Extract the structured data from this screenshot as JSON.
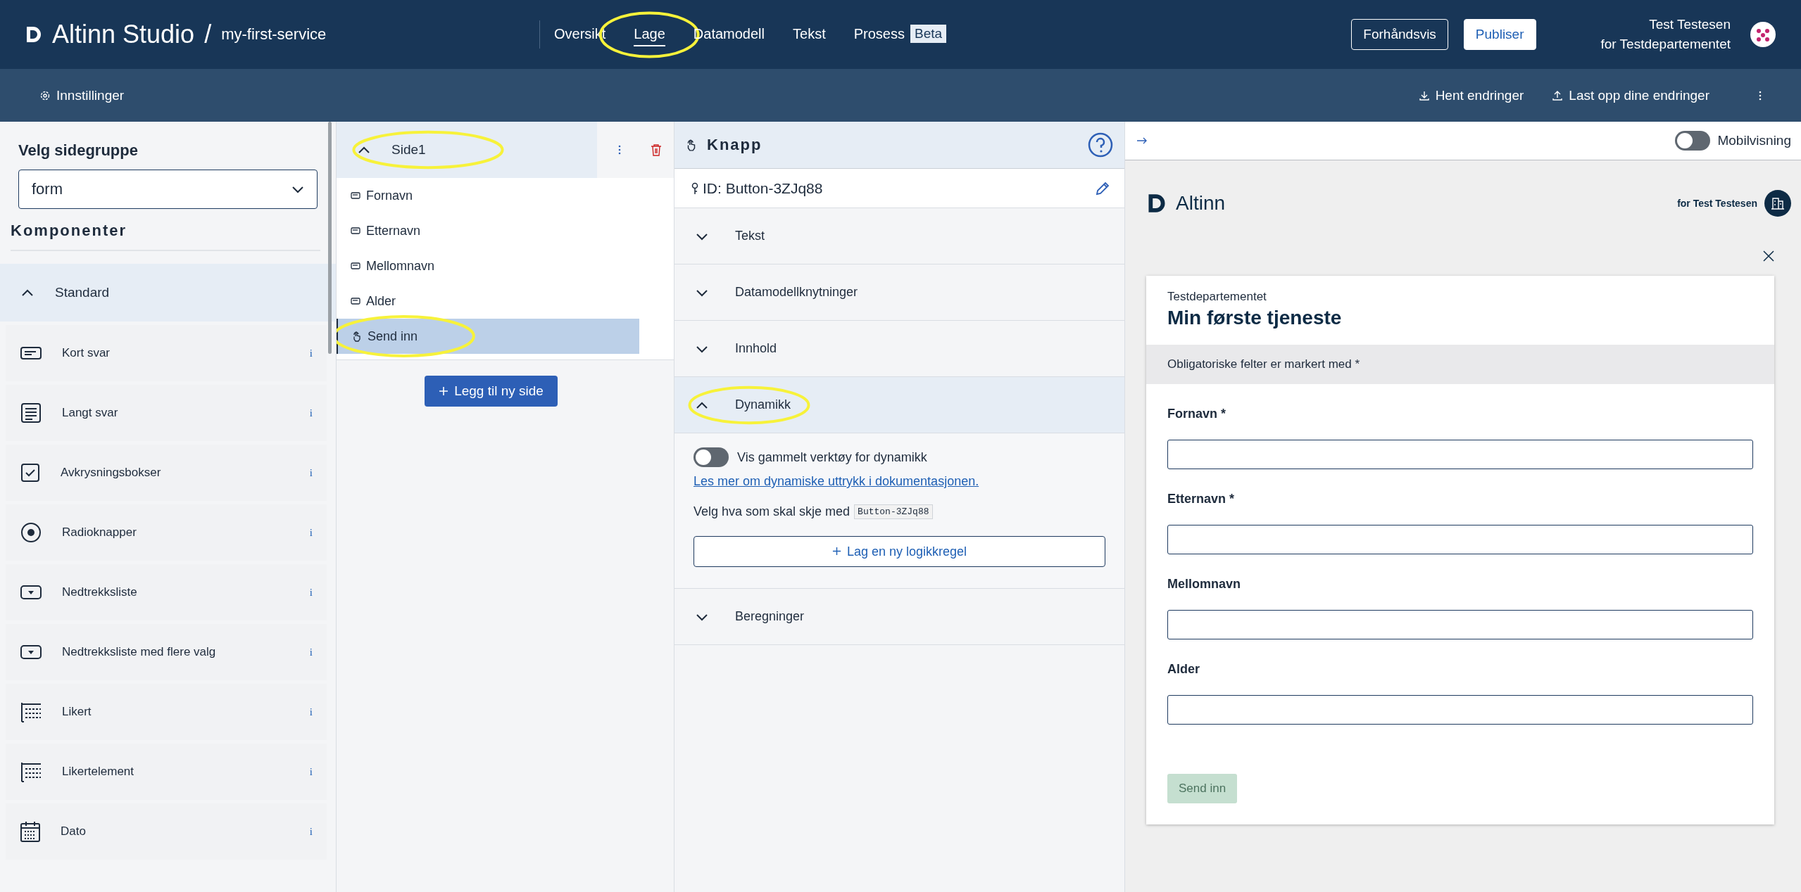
{
  "header": {
    "logo": "Altinn Studio",
    "separator": "/",
    "app_name": "my-first-service",
    "nav": [
      {
        "label": "Oversikt",
        "selected": false,
        "annotated": false
      },
      {
        "label": "Lage",
        "selected": true,
        "annotated": true
      },
      {
        "label": "Datamodell",
        "selected": false,
        "annotated": false
      },
      {
        "label": "Tekst",
        "selected": false,
        "annotated": false
      },
      {
        "label": "Prosess",
        "badge": "Beta",
        "selected": false,
        "annotated": false
      }
    ],
    "preview_button": "Forhåndsvis",
    "publish_button": "Publiser",
    "user": {
      "name": "Test Testesen",
      "org": "for Testdepartementet"
    }
  },
  "subbar": {
    "settings": "Innstillinger",
    "fetch": "Hent endringer",
    "upload": "Last opp dine endringer"
  },
  "components_panel": {
    "group_label": "Velg sidegruppe",
    "group_value": "form",
    "title": "Komponenter",
    "category": {
      "label": "Standard",
      "expanded": true
    },
    "items": [
      {
        "label": "Kort svar",
        "kind": "short",
        "info": "i"
      },
      {
        "label": "Langt svar",
        "kind": "long",
        "info": "i"
      },
      {
        "label": "Avkrysningsbokser",
        "kind": "checkbox",
        "info": "i"
      },
      {
        "label": "Radioknapper",
        "kind": "radio",
        "info": "i"
      },
      {
        "label": "Nedtrekksliste",
        "kind": "dropdown",
        "info": "i"
      },
      {
        "label": "Nedtrekksliste med flere valg",
        "kind": "dropdown",
        "info": "i"
      },
      {
        "label": "Likert",
        "kind": "likert",
        "info": "i"
      },
      {
        "label": "Likertelement",
        "kind": "likert",
        "info": "i"
      },
      {
        "label": "Dato",
        "kind": "date",
        "info": "i"
      }
    ]
  },
  "pages": {
    "items": [
      {
        "label": "Side1",
        "expanded": true,
        "annotated": true,
        "components": [
          {
            "label": "Fornavn",
            "kind": "input",
            "selected": false,
            "annotated": false
          },
          {
            "label": "Etternavn",
            "kind": "input",
            "selected": false,
            "annotated": false
          },
          {
            "label": "Mellomnavn",
            "kind": "input",
            "selected": false,
            "annotated": false
          },
          {
            "label": "Alder",
            "kind": "input",
            "selected": false,
            "annotated": false
          },
          {
            "label": "Send inn",
            "kind": "button",
            "selected": true,
            "annotated": true
          }
        ]
      }
    ],
    "add_page": "Legg til ny side"
  },
  "properties": {
    "title": "Knapp",
    "id_label": "ID: Button-3ZJq88",
    "sections": [
      {
        "label": "Tekst",
        "expanded": false,
        "annotated": false
      },
      {
        "label": "Datamodellknytninger",
        "expanded": false,
        "annotated": false
      },
      {
        "label": "Innhold",
        "expanded": false,
        "annotated": false
      },
      {
        "label": "Dynamikk",
        "expanded": true,
        "annotated": true
      },
      {
        "label": "Beregninger",
        "expanded": false,
        "annotated": false
      }
    ],
    "dynamics": {
      "toggle_label": "Vis gammelt verktøy for dynamikk",
      "on": false,
      "link": "Les mer om dynamiske uttrykk i dokumentasjonen.",
      "choose_label": "Velg hva som skal skje med",
      "component_id": "Button-3ZJq88",
      "add_rule": "Lag en ny logikkregel"
    }
  },
  "preview": {
    "mobile_toggle": {
      "label": "Mobilvisning",
      "on": false
    },
    "logo": "Altinn",
    "party": "for Test Testesen",
    "org": "Testdepartementet",
    "title": "Min første tjeneste",
    "required_note": "Obligatoriske felter er markert med *",
    "fields": [
      {
        "label": "Fornavn *"
      },
      {
        "label": "Etternavn *"
      },
      {
        "label": "Mellomnavn"
      },
      {
        "label": "Alder"
      }
    ],
    "submit": {
      "label": "Send inn",
      "disabled": true
    }
  }
}
